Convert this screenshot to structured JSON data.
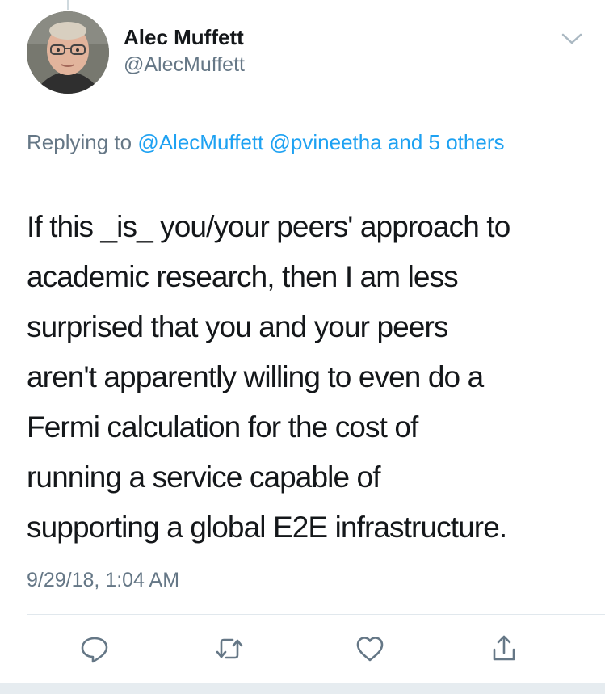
{
  "author": {
    "name": "Alec Muffett",
    "handle": "@AlecMuffett"
  },
  "replying": {
    "prefix": "Replying to",
    "handles": [
      "@AlecMuffett",
      "@pvineetha"
    ],
    "others": "and 5 others"
  },
  "tweet": {
    "lines": [
      "If this _is_ you/your peers' approach to",
      "academic research, then I am less",
      "surprised that you and your peers",
      "aren't apparently willing to even do a",
      "Fermi calculation for the cost of",
      "running a service capable of",
      "supporting a global E2E infrastructure."
    ],
    "timestamp": "9/29/18, 1:04 AM"
  },
  "actions": [
    "reply-icon",
    "retweet-icon",
    "like-icon",
    "share-icon"
  ],
  "colors": {
    "link": "#1da1f2",
    "text": "#14171a",
    "secondary": "#657786",
    "icon": "#657786",
    "divider": "#e1e8ed"
  }
}
